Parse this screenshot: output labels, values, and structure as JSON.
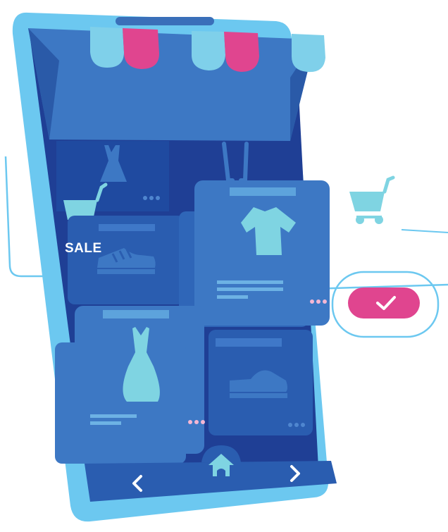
{
  "badge": {
    "sale_label": "SALE"
  },
  "navigation": {
    "back_icon": "chevron-left-icon",
    "home_icon": "home-icon",
    "forward_icon": "chevron-right-icon"
  },
  "actions": {
    "confirm_icon": "checkmark-icon"
  },
  "colors": {
    "phone_frame": "#6cc8f0",
    "screen_dark": "#1f3f95",
    "card_blue": "#3d78c4",
    "awning_blue": "#7fd0ea",
    "awning_pink": "#e0458f",
    "product_cyan": "#7fd4e2",
    "dots_pink": "#f4b7d4",
    "dots_blue": "#8fc3ee"
  },
  "products": [
    {
      "icon": "dress-top-icon"
    },
    {
      "icon": "hanger-icon"
    },
    {
      "icon": "sneaker-icon"
    },
    {
      "icon": "tshirt-icon"
    },
    {
      "icon": "dress-icon"
    },
    {
      "icon": "shoe-icon"
    }
  ],
  "floating": {
    "cart_icon": "shopping-cart-icon"
  }
}
